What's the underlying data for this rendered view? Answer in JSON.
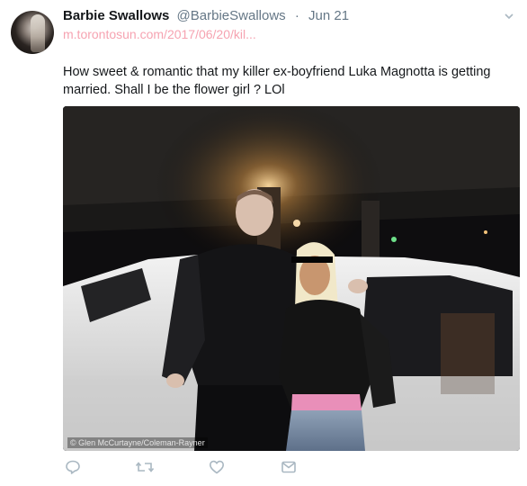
{
  "tweet": {
    "author_name": "Barbie Swallows",
    "author_handle": "@BarbieSwallows",
    "separator": "·",
    "date": "Jun 21",
    "link_text": "m.torontosun.com/2017/06/20/kil...",
    "text": "How sweet & romantic that my killer ex-boyfriend Luka Magnotta is getting married. Shall I be the flower girl ? LOl",
    "photo_credit": "© Glen McCurtayne/Coleman-Rayner"
  },
  "icons": {
    "reply": "reply-icon",
    "retweet": "retweet-icon",
    "like": "heart-icon",
    "message": "envelope-icon",
    "caret": "chevron-down-icon"
  },
  "colors": {
    "link": "#f6a3b1",
    "muted": "#657786",
    "action_icon": "#aab8c2"
  }
}
